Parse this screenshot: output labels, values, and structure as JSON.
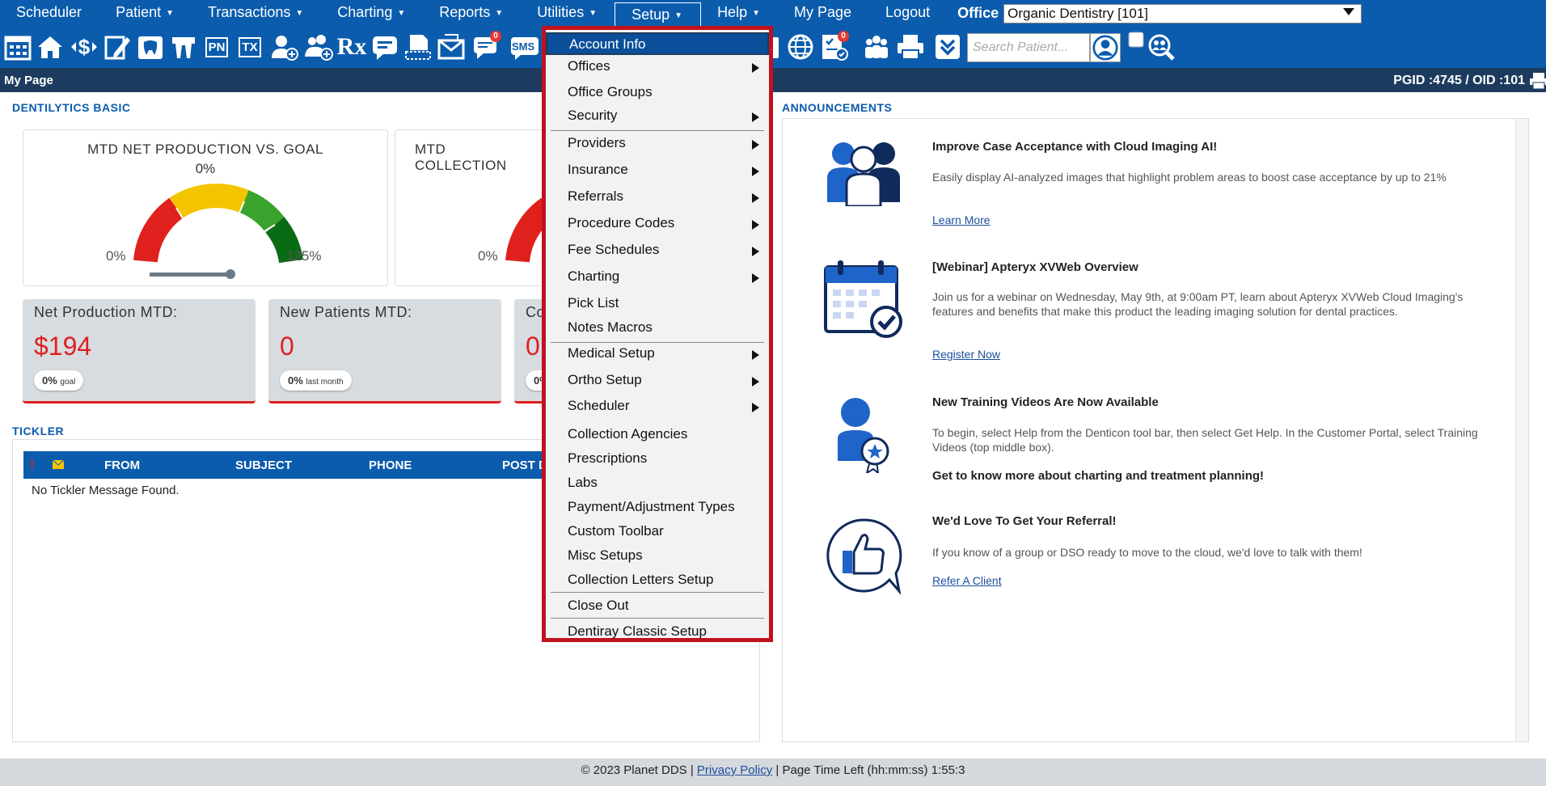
{
  "menubar": {
    "items": [
      {
        "label": "Scheduler",
        "caret": ""
      },
      {
        "label": "Patient",
        "caret": "▼"
      },
      {
        "label": "Transactions",
        "caret": "▼"
      },
      {
        "label": "Charting",
        "caret": "▼"
      },
      {
        "label": "Reports",
        "caret": "▼"
      },
      {
        "label": "Utilities",
        "caret": "▼"
      },
      {
        "label": "Setup",
        "caret": "▼"
      },
      {
        "label": "Help",
        "caret": "▼"
      },
      {
        "label": "My Page",
        "caret": ""
      },
      {
        "label": "Logout",
        "caret": ""
      }
    ],
    "office_label": "Office",
    "office_value": "Organic Dentistry [101]"
  },
  "toolbar": {
    "search_placeholder": "Search Patient...",
    "badge_count": "0",
    "text_icons": {
      "pn": "PN",
      "tx": "TX",
      "rx": "Rx",
      "sms": "SMS"
    }
  },
  "pagebar": {
    "title": "My Page",
    "ids": "PGID :4745  /  OID :101"
  },
  "dentilytics": {
    "section_title": "DENTILYTICS BASIC",
    "gauges": [
      {
        "title": "MTD NET PRODUCTION VS. GOAL",
        "pct": "0%",
        "min": "0%",
        "max": "125%",
        "value": 0
      },
      {
        "title": "MTD COLLECTION",
        "min": "0%",
        "value": 0
      }
    ],
    "stats": [
      {
        "label": "Net Production MTD:",
        "value": "$194",
        "pill_pct": "0%",
        "pill_sub": "goal"
      },
      {
        "label": "New Patients MTD:",
        "value": "0",
        "pill_pct": "0%",
        "pill_sub": "last month"
      },
      {
        "label": "Co",
        "value": "0",
        "pill_pct": "0%",
        "pill_sub": ""
      }
    ]
  },
  "tickler": {
    "section_title": "TICKLER",
    "columns": [
      "FROM",
      "SUBJECT",
      "PHONE",
      "POST D"
    ],
    "empty": "No Tickler Message Found."
  },
  "announcements": {
    "section_title": "ANNOUNCEMENTS",
    "items": [
      {
        "title": "Improve Case Acceptance with Cloud Imaging AI!",
        "body": "Easily display AI-analyzed images that highlight problem areas to boost case acceptance by up to 21%",
        "link": "Learn More"
      },
      {
        "title": "[Webinar] Apteryx XVWeb Overview",
        "body": "Join us for a webinar on Wednesday, May 9th, at 9:00am PT, learn about Apteryx XVWeb Cloud Imaging's features and benefits that make this product the leading imaging solution for dental practices.",
        "link": "Register Now"
      },
      {
        "title": "New Training Videos Are Now Available",
        "body": "To begin, select Help from the Denticon tool bar, then select Get Help. In the Customer Portal, select Training Videos (top middle box).",
        "bold": "Get to know more about charting and treatment planning!"
      },
      {
        "title": "We'd Love To Get Your Referral!",
        "body": "If you know of a group or DSO ready to move to the cloud, we'd love to talk with them!",
        "link": "Refer A Client"
      }
    ]
  },
  "setup_menu": {
    "items": [
      {
        "label": "Account Info",
        "submenu": false
      },
      {
        "label": "Offices",
        "submenu": true
      },
      {
        "label": "Office Groups",
        "submenu": false
      },
      {
        "label": "Security",
        "submenu": true
      },
      {
        "label": "Providers",
        "submenu": true
      },
      {
        "label": "Insurance",
        "submenu": true
      },
      {
        "label": "Referrals",
        "submenu": true
      },
      {
        "label": "Procedure Codes",
        "submenu": true
      },
      {
        "label": "Fee Schedules",
        "submenu": true
      },
      {
        "label": "Charting",
        "submenu": true
      },
      {
        "label": "Pick List",
        "submenu": false
      },
      {
        "label": "Notes Macros",
        "submenu": false
      },
      {
        "label": "Medical Setup",
        "submenu": true
      },
      {
        "label": "Ortho Setup",
        "submenu": true
      },
      {
        "label": "Scheduler",
        "submenu": true
      },
      {
        "label": "Collection Agencies",
        "submenu": false
      },
      {
        "label": "Prescriptions",
        "submenu": false
      },
      {
        "label": "Labs",
        "submenu": false
      },
      {
        "label": "Payment/Adjustment Types",
        "submenu": false
      },
      {
        "label": "Custom Toolbar",
        "submenu": false
      },
      {
        "label": "Misc Setups",
        "submenu": false
      },
      {
        "label": "Collection Letters Setup",
        "submenu": false
      },
      {
        "label": "Close Out",
        "submenu": false
      },
      {
        "label": "Dentiray Classic Setup",
        "submenu": false
      }
    ]
  },
  "footer": {
    "copyright": "© 2023 Planet DDS | ",
    "privacy": "Privacy Policy",
    "time_left": " |  Page Time Left (hh:mm:ss) 1:55:3"
  },
  "colors": {
    "brand_blue": "#0b5cad",
    "header_navy": "#1d3b5f",
    "highlight_red": "#c0111f",
    "value_red": "#e02020"
  }
}
